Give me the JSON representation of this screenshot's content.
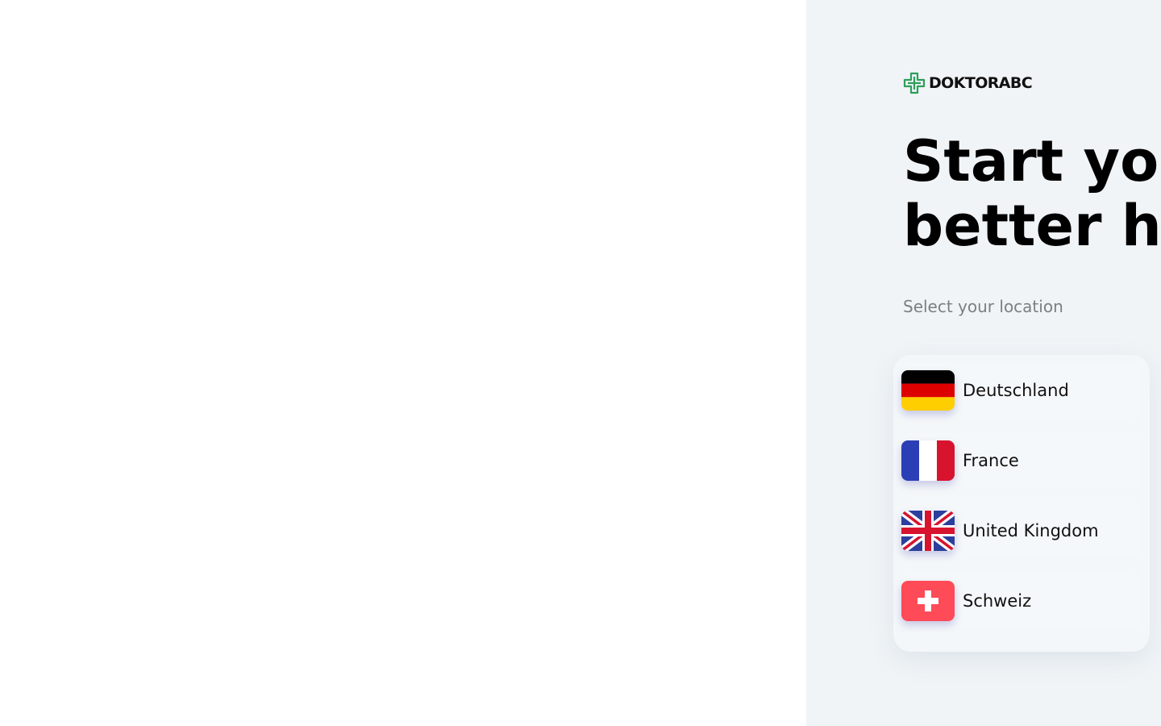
{
  "brand": {
    "name": "DOKTORABC",
    "accent_color": "#2e9e5b"
  },
  "hero": {
    "headline_line1": "Start yo",
    "headline_line2": "better h"
  },
  "location_picker": {
    "subtitle": "Select your location",
    "items": [
      {
        "label": "Deutschland",
        "flag": "germany-flag-icon"
      },
      {
        "label": "France",
        "flag": "france-flag-icon"
      },
      {
        "label": "United Kingdom",
        "flag": "uk-flag-icon"
      },
      {
        "label": "Schweiz",
        "flag": "switzerland-flag-icon"
      }
    ]
  }
}
